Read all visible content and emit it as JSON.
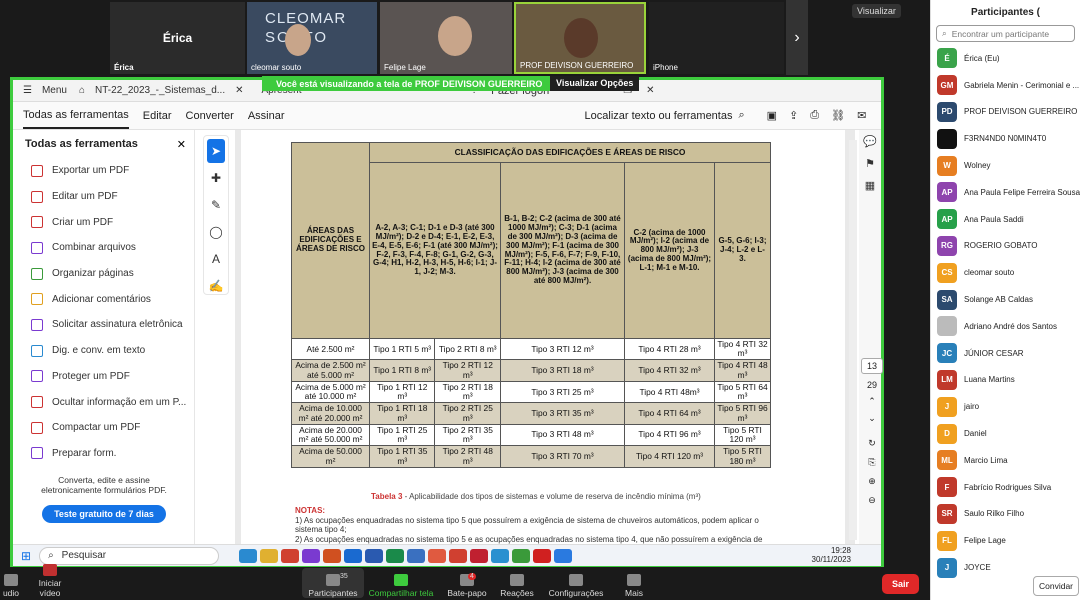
{
  "zoom": {
    "tiles": [
      {
        "name": "Érica",
        "label": "Érica"
      },
      {
        "name": "cleomar souto",
        "label": "cleomar souto",
        "bg_text_1": "CLEOMAR",
        "bg_text_2": "SOUTO"
      },
      {
        "name": "Felipe Lage",
        "label": "Felipe Lage"
      },
      {
        "name": "PROF DEIVISON GUERREIRO",
        "label": "PROF DEIVISON GUERREIRO"
      },
      {
        "name": "iPhone",
        "label": "iPhone"
      }
    ],
    "visualizar": "Visualizar",
    "banner": "Você está visualizando a tela de  PROF DEIVISON GUERREIRO",
    "banner_opts": "Visualizar Opções",
    "bottom": {
      "audio": "udio",
      "video": "Iniciar vídeo",
      "participants": "Participantes",
      "participants_count": "35",
      "share": "Compartilhar tela",
      "chat": "Bate-papo",
      "chat_badge": "4",
      "reactions": "Reações",
      "settings": "Configurações",
      "more": "Mais",
      "leave": "Sair"
    }
  },
  "acrobat": {
    "menu": "Menu",
    "doc_title": "NT-22_2023_-_Sistemas_d...",
    "doc_tab2": "Apresent",
    "login": "Fazer logon",
    "tabs": [
      "Todas as ferramentas",
      "Editar",
      "Converter",
      "Assinar"
    ],
    "search": "Localizar texto ou ferramentas",
    "panel_title": "Todas as ferramentas",
    "tools": [
      "Exportar um PDF",
      "Editar um PDF",
      "Criar um PDF",
      "Combinar arquivos",
      "Organizar páginas",
      "Adicionar comentários",
      "Solicitar assinatura eletrônica",
      "Dig. e conv. em texto",
      "Proteger um PDF",
      "Ocultar informação em um P...",
      "Compactar um PDF",
      "Preparar form."
    ],
    "footer_text": "Converta, edite e assine eletronicamente formulários PDF.",
    "trial": "Teste gratuito de 7 dias",
    "page_current": "13",
    "page_total": "29"
  },
  "table": {
    "title": "CLASSIFICAÇÃO DAS EDIFICAÇÕES E ÁREAS DE RISCO",
    "rowhead": "ÁREAS DAS EDIFICAÇÕES E ÁREAS DE RISCO",
    "cols": [
      "A-2, A-3; C-1; D-1 e D-3 (até 300 MJ/m²); D-2 e D-4; E-1, E-2, E-3, E-4, E-5, E-6; F-1 (até 300 MJ/m²); F-2, F-3, F-4, F-8; G-1, G-2, G-3, G-4; H1, H-2, H-3, H-5, H-6; I-1; J-1, J-2; M-3.",
      "B-1, B-2; C-2 (acima de 300 até 1000 MJ/m²); C-3; D-1 (acima de 300 MJ/m²); D-3 (acima de 300 MJ/m²); F-1 (acima de 300 MJ/m²); F-5, F-6, F-7; F-9, F-10, F-11; H-4; I-2 (acima de 300 até 800 MJ/m²); J-3 (acima de 300 até 800 MJ/m²).",
      "C-2 (acima de 1000 MJ/m²); I-2 (acima de 800 MJ/m²); J-3 (acima de 800 MJ/m²); L-1; M-1 e M-10.",
      "G-5, G-6; I-3; J-4; L-2 e L-3."
    ],
    "rows": [
      {
        "area": "Até 2.500 m²",
        "c": [
          "Tipo 1 RTI 5 m³",
          "Tipo 2 RTI 8 m³",
          "Tipo 3 RTI 12 m³",
          "Tipo 4 RTI 28 m³",
          "Tipo 4 RTI 32 m³"
        ]
      },
      {
        "area": "Acima de 2.500 m² até 5.000 m²",
        "c": [
          "Tipo 1 RTI 8 m³",
          "Tipo 2 RTI 12 m³",
          "Tipo 3 RTI 18 m³",
          "Tipo 4 RTI 32 m³",
          "Tipo 4 RTI 48 m³"
        ]
      },
      {
        "area": "Acima de 5.000 m² até 10.000 m²",
        "c": [
          "Tipo 1 RTI 12 m³",
          "Tipo 2 RTI 18 m³",
          "Tipo 3 RTI 25 m³",
          "Tipo 4 RTI 48m³",
          "Tipo 5 RTI 64 m³"
        ]
      },
      {
        "area": "Acima de 10.000 m² até 20.000 m²",
        "c": [
          "Tipo 1 RTI 18 m³",
          "Tipo 2 RTI 25 m³",
          "Tipo 3 RTI 35 m³",
          "Tipo 4 RTI 64 m³",
          "Tipo 5 RTI 96 m³"
        ]
      },
      {
        "area": "Acima de 20.000 m² até 50.000 m²",
        "c": [
          "Tipo 1 RTI 25 m³",
          "Tipo 2 RTI 35 m³",
          "Tipo 3 RTI 48 m³",
          "Tipo 4 RTI 96 m³",
          "Tipo 5 RTI 120 m³"
        ]
      },
      {
        "area": "Acima de 50.000 m²",
        "c": [
          "Tipo 1 RTI 35 m³",
          "Tipo 2 RTI 48 m³",
          "Tipo 3 RTI 70 m³",
          "Tipo 4 RTI 120 m³",
          "Tipo 5 RTI 180 m³"
        ]
      }
    ],
    "caption_label": "Tabela 3",
    "caption_text": " - Aplicabilidade dos tipos de sistemas e volume de reserva de incêndio mínima (m³)",
    "notes_title": "NOTAS:",
    "note1": "1) As ocupações enquadradas no sistema tipo 5 que possuírem a exigência de sistema de chuveiros automáticos, podem aplicar o sistema tipo 4;",
    "note2": "2) As ocupações enquadradas no sistema tipo 5 e as ocupações enquadradas no sistema tipo 4, que não possuírem a exigência de"
  },
  "taskbar": {
    "search": "Pesquisar",
    "time": "19:28",
    "date": "30/11/2023"
  },
  "participants": {
    "title": "Participantes (",
    "search_placeholder": "Encontrar um participante",
    "invite": "Convidar",
    "list": [
      {
        "initials": "É",
        "name": "Érica (Eu)",
        "color": "#3aa34a"
      },
      {
        "initials": "GM",
        "name": "Gabriela Menin - Cerimonial e ...",
        "color": "#c0392b"
      },
      {
        "initials": "PD",
        "name": "PROF DEIVISON GUERREIRO (Coa",
        "color": "#2c4a6e"
      },
      {
        "initials": "",
        "name": "F3RN4ND0 N0MIN4T0",
        "color": "#111111"
      },
      {
        "initials": "W",
        "name": "Wolney",
        "color": "#e67e22"
      },
      {
        "initials": "AP",
        "name": "Ana Paula Felipe Ferreira Sousa",
        "color": "#8e44ad"
      },
      {
        "initials": "AP",
        "name": "Ana Paula Saddi",
        "color": "#27a04a"
      },
      {
        "initials": "RG",
        "name": "ROGERIO GOBATO",
        "color": "#8e44ad"
      },
      {
        "initials": "CS",
        "name": "cleomar souto",
        "color": "#f0a020"
      },
      {
        "initials": "SA",
        "name": "Solange AB Caldas",
        "color": "#2c4a6e"
      },
      {
        "initials": "",
        "name": "Adriano André dos Santos",
        "color": "#bbbbbb"
      },
      {
        "initials": "JC",
        "name": "JÚNIOR CESAR",
        "color": "#2980b9"
      },
      {
        "initials": "LM",
        "name": "Luana Martins",
        "color": "#c0392b"
      },
      {
        "initials": "J",
        "name": "jairo",
        "color": "#f0a020"
      },
      {
        "initials": "D",
        "name": "Daniel",
        "color": "#f0a020"
      },
      {
        "initials": "ML",
        "name": "Marcio Lima",
        "color": "#e67e22"
      },
      {
        "initials": "F",
        "name": "Fabrício Rodrigues Silva",
        "color": "#c0392b"
      },
      {
        "initials": "SR",
        "name": "Saulo Rilko Filho",
        "color": "#c0392b"
      },
      {
        "initials": "FL",
        "name": "Felipe Lage",
        "color": "#f0a020"
      },
      {
        "initials": "J",
        "name": "JOYCE",
        "color": "#2980b9"
      }
    ]
  }
}
